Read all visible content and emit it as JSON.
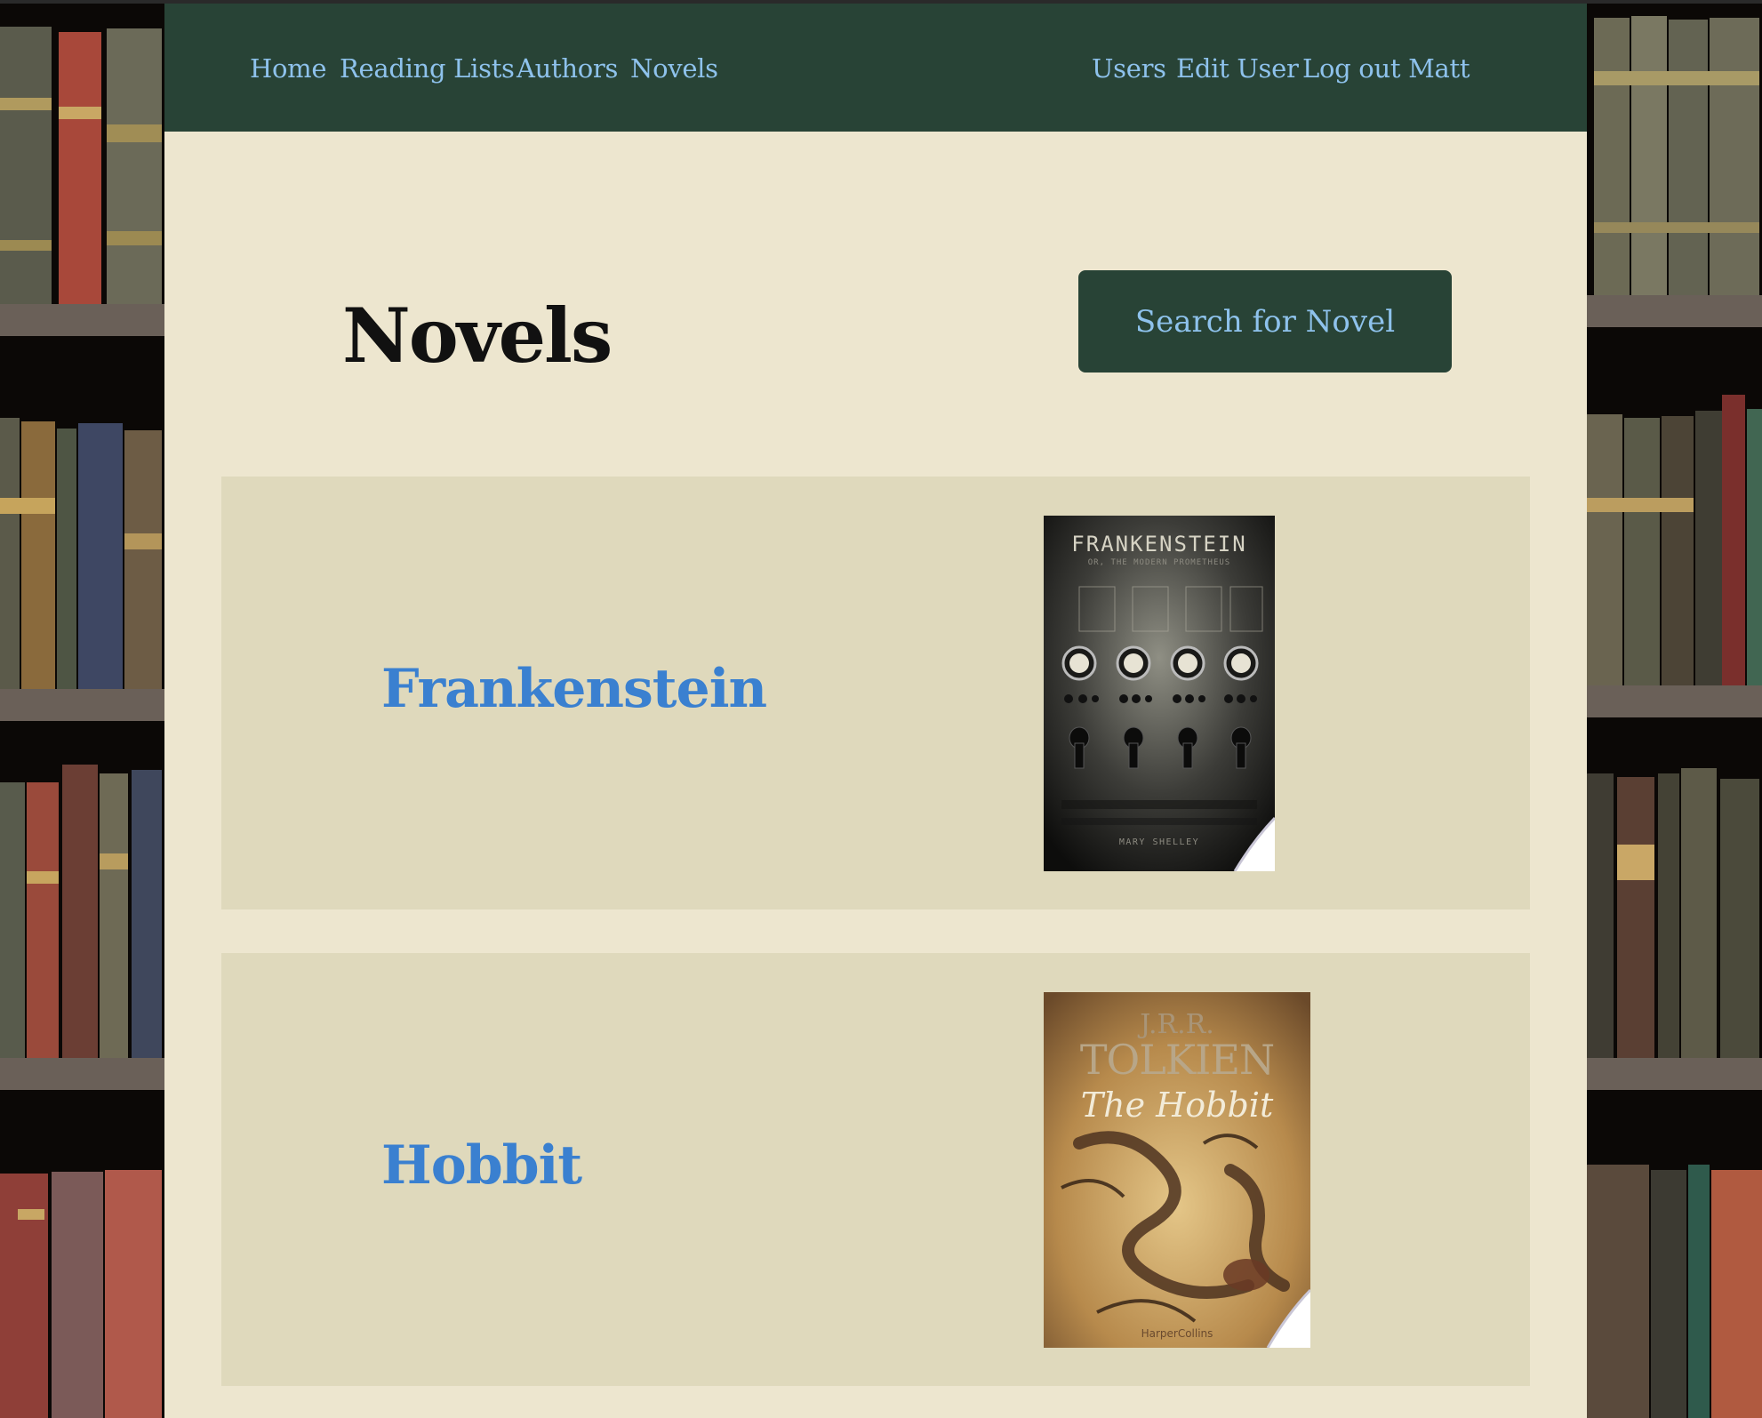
{
  "nav": {
    "left": [
      {
        "label": "Home"
      },
      {
        "label": "Reading Lists"
      },
      {
        "label": "Authors"
      },
      {
        "label": "Novels"
      }
    ],
    "right": [
      {
        "label": "Users"
      },
      {
        "label": "Edit User"
      },
      {
        "label": "Log out Matt"
      }
    ]
  },
  "page": {
    "title": "Novels",
    "search_button": "Search for Novel"
  },
  "novels": [
    {
      "title": "Frankenstein",
      "cover": {
        "title": "FRANKENSTEIN",
        "subtitle": "OR, THE MODERN PROMETHEUS",
        "author": "MARY SHELLEY"
      }
    },
    {
      "title": "Hobbit",
      "cover": {
        "author_initials": "J.R.R.",
        "author_surname": "TOLKIEN",
        "title": "The Hobbit",
        "publisher": "HarperCollins"
      }
    }
  ],
  "colors": {
    "navbar": "#284336",
    "link": "#8ec2ec",
    "novel_link": "#3a80d0",
    "page_bg": "#ede6cf",
    "card_bg": "#dfd9bc"
  }
}
